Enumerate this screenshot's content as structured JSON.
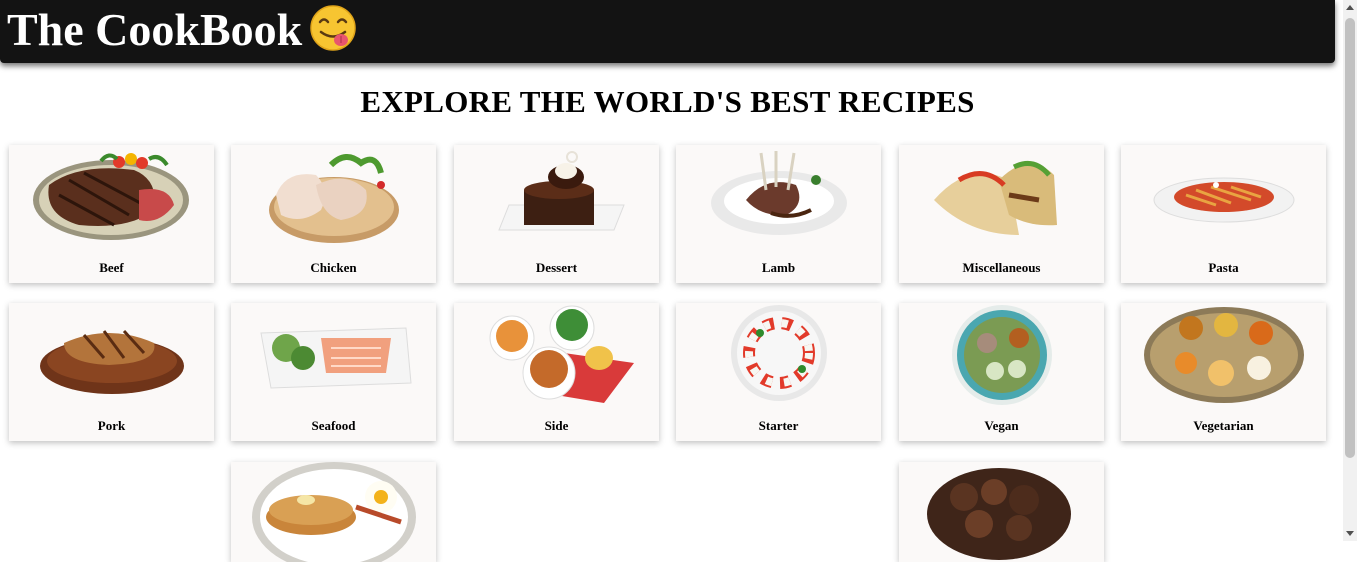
{
  "header": {
    "title": "The CookBook"
  },
  "main": {
    "heading": "EXPLORE THE WORLD'S BEST RECIPES",
    "categories": [
      {
        "label": "Beef"
      },
      {
        "label": "Chicken"
      },
      {
        "label": "Dessert"
      },
      {
        "label": "Lamb"
      },
      {
        "label": "Miscellaneous"
      },
      {
        "label": "Pasta"
      },
      {
        "label": "Pork"
      },
      {
        "label": "Seafood"
      },
      {
        "label": "Side"
      },
      {
        "label": "Starter"
      },
      {
        "label": "Vegan"
      },
      {
        "label": "Vegetarian"
      },
      {
        "label": ""
      },
      {
        "label": ""
      }
    ]
  }
}
